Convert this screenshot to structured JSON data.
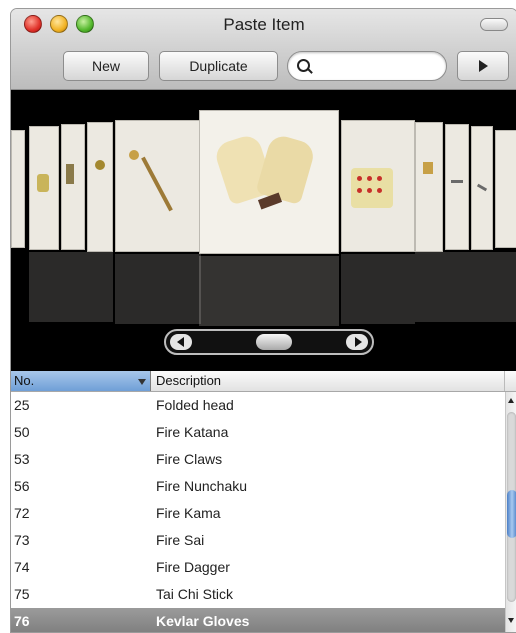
{
  "window": {
    "title": "Paste Item",
    "traffic_lights": [
      "close-button",
      "minimize-button",
      "zoom-button"
    ]
  },
  "toolbar": {
    "new_label": "New",
    "duplicate_label": "Duplicate",
    "search_value": "",
    "next_icon": "play-right-icon"
  },
  "coverflow": {
    "selected_item": "Kevlar Gloves",
    "slider_position": 0.5
  },
  "table": {
    "columns": [
      "No.",
      "Description"
    ],
    "sort_column": "No.",
    "rows": [
      {
        "no": "25",
        "desc": "Folded head"
      },
      {
        "no": "50",
        "desc": "Fire Katana"
      },
      {
        "no": "53",
        "desc": "Fire Claws"
      },
      {
        "no": "56",
        "desc": "Fire Nunchaku"
      },
      {
        "no": "72",
        "desc": "Fire Kama"
      },
      {
        "no": "73",
        "desc": "Fire Sai"
      },
      {
        "no": "74",
        "desc": "Fire Dagger"
      },
      {
        "no": "75",
        "desc": "Tai Chi Stick"
      },
      {
        "no": "76",
        "desc": "Kevlar Gloves"
      }
    ],
    "selected_row": "76"
  },
  "colors": {
    "header_sorted": "#6f9fd7",
    "selected_row": "#8a8a8a",
    "coverflow_bg": "#000000"
  }
}
